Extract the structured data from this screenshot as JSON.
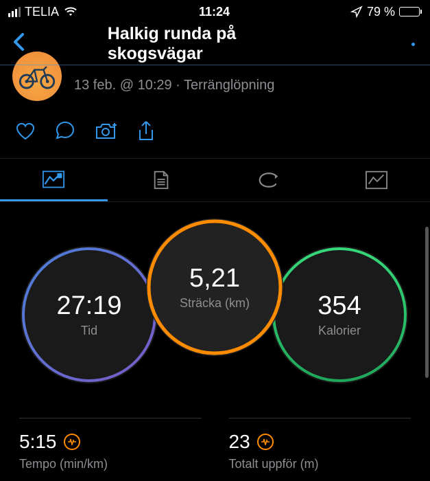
{
  "status": {
    "carrier": "TELIA",
    "time": "11:24",
    "battery": "79 %"
  },
  "nav": {
    "title": "Halkig runda på skogsvägar"
  },
  "activity": {
    "meta": "13 feb. @ 10:29 · Terränglöpning"
  },
  "gauges": {
    "time": {
      "value": "27:19",
      "label": "Tid"
    },
    "distance": {
      "value": "5,21",
      "label": "Sträcka (km)"
    },
    "calories": {
      "value": "354",
      "label": "Kalorier"
    }
  },
  "stats": {
    "pace": {
      "value": "5:15",
      "label": "Tempo (min/km)"
    },
    "ascent": {
      "value": "23",
      "label": "Totalt uppför (m)"
    }
  }
}
